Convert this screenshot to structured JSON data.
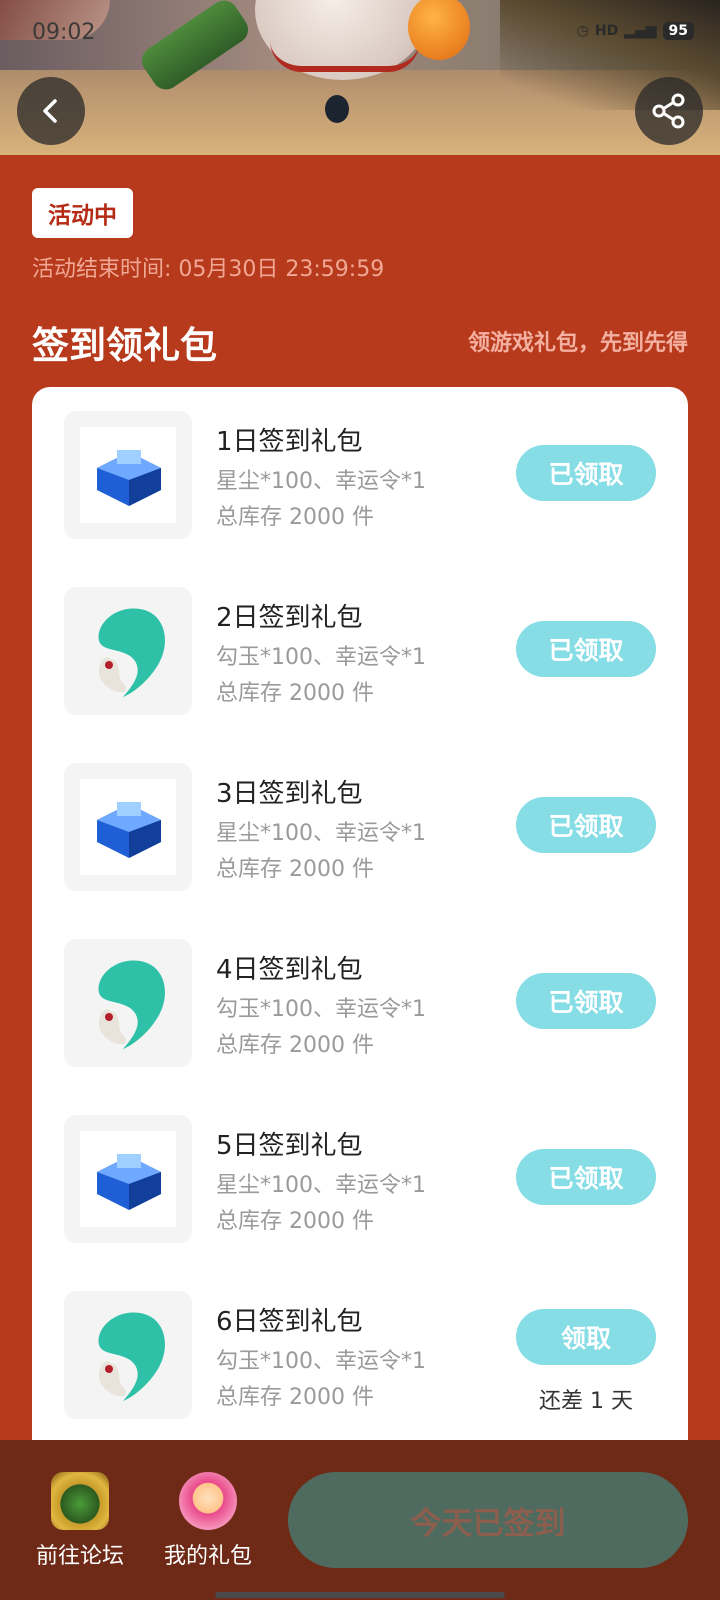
{
  "status_bar": {
    "time": "09:02",
    "battery": "95"
  },
  "header": {
    "back_label": "<",
    "share_label": "share"
  },
  "event": {
    "tag": "活动中",
    "end_time": "活动结束时间: 05月30日 23:59:59"
  },
  "section": {
    "title": "签到领礼包",
    "subtitle": "领游戏礼包，先到先得"
  },
  "packs": [
    {
      "name": "1日签到礼包",
      "desc": "星尘*100、幸运令*1",
      "stock": "总库存 2000 件",
      "button": "已领取",
      "icon": "blue-crystal-chest-icon"
    },
    {
      "name": "2日签到礼包",
      "desc": "勾玉*100、幸运令*1",
      "stock": "总库存 2000 件",
      "button": "已领取",
      "icon": "jade-magatama-icon"
    },
    {
      "name": "3日签到礼包",
      "desc": "星尘*100、幸运令*1",
      "stock": "总库存 2000 件",
      "button": "已领取",
      "icon": "blue-crystal-chest-icon"
    },
    {
      "name": "4日签到礼包",
      "desc": "勾玉*100、幸运令*1",
      "stock": "总库存 2000 件",
      "button": "已领取",
      "icon": "jade-magatama-icon"
    },
    {
      "name": "5日签到礼包",
      "desc": "星尘*100、幸运令*1",
      "stock": "总库存 2000 件",
      "button": "已领取",
      "icon": "blue-crystal-chest-icon"
    },
    {
      "name": "6日签到礼包",
      "desc": "勾玉*100、幸运令*1",
      "stock": "总库存 2000 件",
      "button": "领取",
      "remain": "还差 1 天",
      "icon": "jade-magatama-icon"
    }
  ],
  "bottom_bar": {
    "forum_label": "前往论坛",
    "gifts_label": "我的礼包",
    "signed_label": "今天已签到"
  },
  "colors": {
    "background": "#b83a1c",
    "claim_button": "#86dde6",
    "signed_button": "#4f6b5f",
    "bottom_bar": "#6e2a17"
  }
}
